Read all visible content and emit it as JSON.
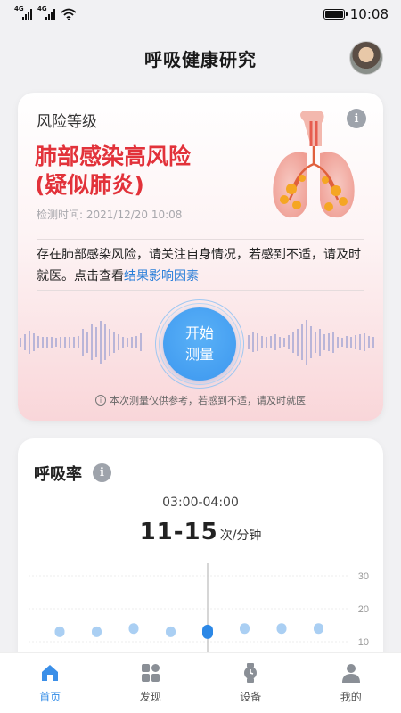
{
  "status_bar": {
    "network_1": "4G",
    "network_2": "4G",
    "time": "10:08"
  },
  "header": {
    "title": "呼吸健康研究"
  },
  "risk_card": {
    "label": "风险等级",
    "title_line1": "肺部感染高风险",
    "title_line2": "(疑似肺炎)",
    "detect_time": "检测时间: 2021/12/20 10:08",
    "advice_text": "存在肺部感染风险，请关注自身情况，若感到不适，请及时就医。点击查看",
    "advice_link": "结果影响因素",
    "measure_line1": "开始",
    "measure_line2": "测量",
    "disclaimer": "本次测量仅供参考，若感到不适，请及时就医",
    "accent_color": "#e2323a",
    "link_color": "#2a7fd9"
  },
  "resp_card": {
    "title": "呼吸率",
    "time_range": "03:00-04:00",
    "rate_value": "11-15",
    "rate_unit": "次/分钟"
  },
  "chart_data": {
    "type": "scatter",
    "y_ticks": [
      "30",
      "20",
      "10"
    ],
    "ylim": [
      10,
      30
    ],
    "values": [
      13,
      13,
      14,
      13,
      13,
      14,
      14,
      14
    ],
    "selected_index": 4,
    "point_color": "#aacff3",
    "selected_color": "#2c88e6"
  },
  "bottom_nav": {
    "items": [
      {
        "label": "首页",
        "icon": "home-icon",
        "active": true
      },
      {
        "label": "发现",
        "icon": "discover-icon",
        "active": false
      },
      {
        "label": "设备",
        "icon": "watch-icon",
        "active": false
      },
      {
        "label": "我的",
        "icon": "profile-icon",
        "active": false
      }
    ]
  }
}
